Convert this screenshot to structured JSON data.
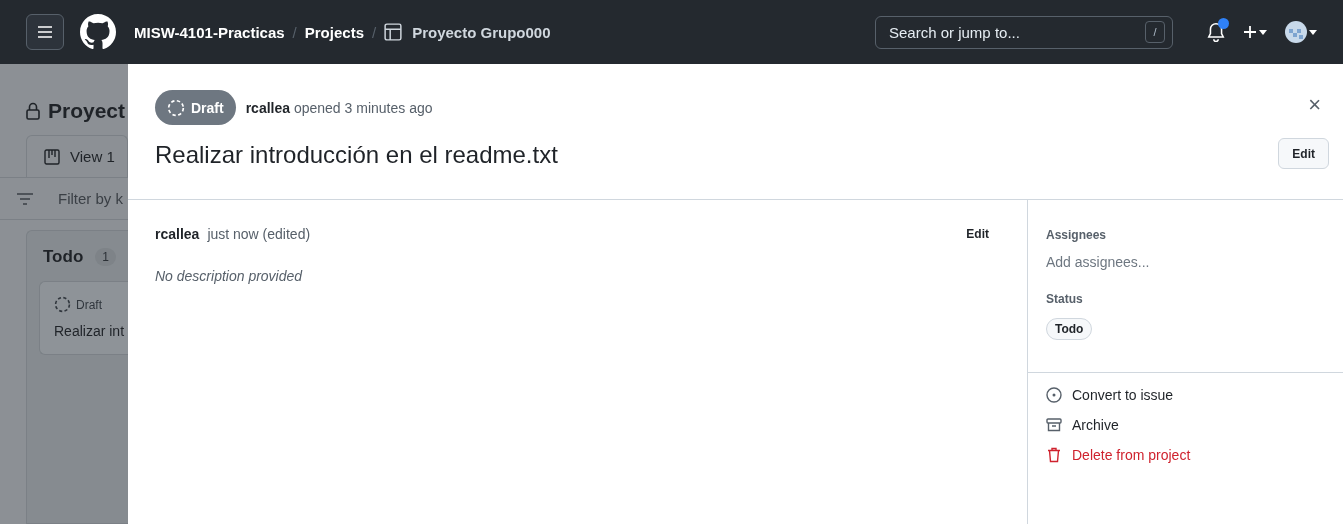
{
  "header": {
    "breadcrumbs": [
      {
        "label": "MISW-4101-Practicas",
        "kind": "link"
      },
      {
        "label": "Projects",
        "kind": "link"
      },
      {
        "label": "Proyecto Grupo000",
        "kind": "project"
      }
    ],
    "separator": "/",
    "search": {
      "placeholder": "Search or jump to...",
      "shortcut": "/"
    },
    "notifications": {
      "unread": true
    }
  },
  "background": {
    "project_title": "Proyect",
    "view_tab": "View 1",
    "filter_placeholder": "Filter by k",
    "column": {
      "title": "Todo",
      "count": "1",
      "card": {
        "state": "Draft",
        "title": "Realizar int"
      }
    }
  },
  "item": {
    "state": "Draft",
    "author": "rcallea",
    "opened": "opened 3 minutes ago",
    "title": "Realizar introducción en el readme.txt",
    "edit": "Edit",
    "close": "×",
    "comment": {
      "author": "rcallea",
      "time": "just now (edited)",
      "edit": "Edit",
      "body": "No description provided"
    }
  },
  "sidebar": {
    "fields": [
      {
        "label": "Assignees",
        "kind": "empty",
        "value": "Add assignees..."
      },
      {
        "label": "Status",
        "kind": "token",
        "value": "Todo"
      }
    ],
    "actions": [
      {
        "label": "Convert to issue",
        "kind": "convert"
      },
      {
        "label": "Archive",
        "kind": "archive"
      },
      {
        "label": "Delete from project",
        "kind": "delete"
      }
    ]
  }
}
